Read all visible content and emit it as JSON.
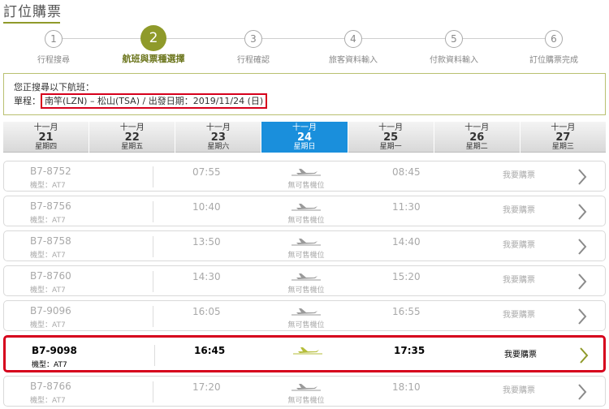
{
  "page_title": "訂位購票",
  "steps": [
    {
      "num": "1",
      "label": "行程搜尋"
    },
    {
      "num": "2",
      "label": "航班與票種選擇"
    },
    {
      "num": "3",
      "label": "行程確認"
    },
    {
      "num": "4",
      "label": "旅客資料輸入"
    },
    {
      "num": "5",
      "label": "付款資料輸入"
    },
    {
      "num": "6",
      "label": "訂位購票完成"
    }
  ],
  "search": {
    "intro": "您正搜尋以下航班：",
    "trip_label": "單程：",
    "route": "南竿(LZN) – 松山(TSA)",
    "divider": "/",
    "date_label": "出發日期：",
    "date": "2019/11/24 (日)"
  },
  "date_tabs": [
    {
      "month": "十一月",
      "day": "21",
      "weekday": "星期四"
    },
    {
      "month": "十一月",
      "day": "22",
      "weekday": "星期五"
    },
    {
      "month": "十一月",
      "day": "23",
      "weekday": "星期六"
    },
    {
      "month": "十一月",
      "day": "24",
      "weekday": "星期日"
    },
    {
      "month": "十一月",
      "day": "25",
      "weekday": "星期一"
    },
    {
      "month": "十一月",
      "day": "26",
      "weekday": "星期二"
    },
    {
      "month": "十一月",
      "day": "27",
      "weekday": "星期三"
    }
  ],
  "active_date_index": 3,
  "flights": [
    {
      "no": "B7-8752",
      "type": "機型：AT7",
      "dep": "07:55",
      "seat": "無可售機位",
      "arr": "08:45",
      "buy": "我要購票"
    },
    {
      "no": "B7-8756",
      "type": "機型：AT7",
      "dep": "10:40",
      "seat": "無可售機位",
      "arr": "11:30",
      "buy": "我要購票"
    },
    {
      "no": "B7-8758",
      "type": "機型：AT7",
      "dep": "13:50",
      "seat": "無可售機位",
      "arr": "14:40",
      "buy": "我要購票"
    },
    {
      "no": "B7-8760",
      "type": "機型：AT7",
      "dep": "14:30",
      "seat": "無可售機位",
      "arr": "15:20",
      "buy": "我要購票"
    },
    {
      "no": "B7-9096",
      "type": "機型：AT7",
      "dep": "16:05",
      "seat": "無可售機位",
      "arr": "16:55",
      "buy": "我要購票"
    },
    {
      "no": "B7-9098",
      "type": "機型：AT7",
      "dep": "16:45",
      "seat": "",
      "arr": "17:35",
      "buy": "我要購票"
    },
    {
      "no": "B7-8766",
      "type": "機型：AT7",
      "dep": "17:20",
      "seat": "無可售機位",
      "arr": "18:10",
      "buy": "我要購票"
    }
  ],
  "colors": {
    "accent": "#8f9a2a",
    "active_tab": "#1a8fdc",
    "highlight_border": "#d6001c",
    "muted_text": "#a9a9a9"
  },
  "icons": {
    "plane": "plane-icon",
    "chevron": "chevron-right-icon"
  }
}
